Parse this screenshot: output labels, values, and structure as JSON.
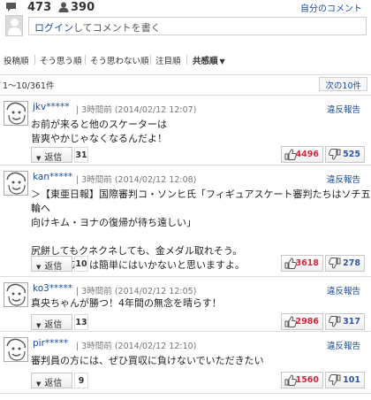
{
  "header": {
    "comment_count": "473",
    "user_count": "390",
    "my_comments_link": "自分のコメント"
  },
  "login": {
    "prompt_link": "ログイン",
    "prompt_rest": "してコメントを書く"
  },
  "sort_tabs": [
    {
      "label": "投稿順"
    },
    {
      "label": "そう思う順"
    },
    {
      "label": "そう思わない順"
    },
    {
      "label": "注目順"
    },
    {
      "label": "共感順"
    }
  ],
  "pagination": {
    "range": "1〜10/361件",
    "next": "次の10件"
  },
  "ui": {
    "reply_label": "返信",
    "report_label": "違反報告"
  },
  "comments": [
    {
      "user": "jkv*****",
      "time": "3時間前",
      "date": "(2014/02/12 12:07)",
      "body": "お前が来ると他のスケーターは\n皆爽やかじゃなくなるんだよ！",
      "replies": "31",
      "agree": "4496",
      "disagree": "525"
    },
    {
      "user": "kan*****",
      "time": "3時間前",
      "date": "(2014/02/12 12:08)",
      "body": "＞【東亜日報】国際審判コ・ソンヒ氏「フィギュアスケート審判たちはソチ五輪へ\n向けキム・ヨナの復帰が待ち遠しい」\n\n尻餅してもクネクネしても、金メダル取れそう。\nでもロシアでは簡単にはいかないと思いますよ。",
      "replies": "10",
      "agree": "3618",
      "disagree": "278"
    },
    {
      "user": "ko3*****",
      "time": "3時間前",
      "date": "(2014/02/12 12:05)",
      "body": "真央ちゃんが勝つ！4年間の無念を晴らす！",
      "replies": "13",
      "agree": "2986",
      "disagree": "317"
    },
    {
      "user": "pir*****",
      "time": "3時間前",
      "date": "(2014/02/12 12:10)",
      "body": "審判員の方には、ぜひ買収に負けないでいただきたい",
      "replies": "9",
      "agree": "1560",
      "disagree": "101"
    }
  ]
}
